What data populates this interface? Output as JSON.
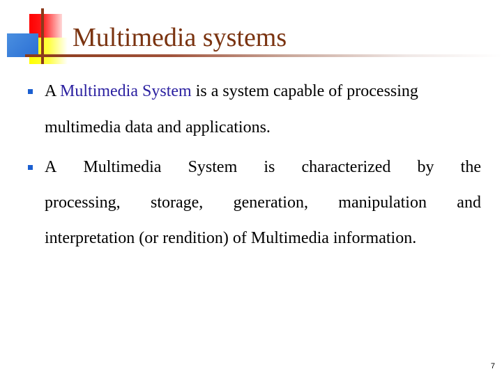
{
  "slide": {
    "title": "Multimedia systems",
    "bullets": [
      {
        "lines": [
          {
            "parts": [
              "A ",
              "Multimedia System",
              " is a system capable of processing"
            ]
          },
          {
            "text": "multimedia data and applications."
          }
        ]
      },
      {
        "lines": [
          {
            "words": [
              "A",
              "Multimedia",
              "System",
              "is",
              "characterized",
              "by",
              "the"
            ]
          },
          {
            "words": [
              "processing,",
              "storage,",
              "generation,",
              "manipulation",
              "and"
            ]
          },
          {
            "text": "interpretation (or rendition) of Multimedia information."
          }
        ]
      }
    ],
    "page_number": "7"
  },
  "colors": {
    "title": "#7a3310",
    "highlight": "#2a1fa0",
    "bullet": "#1b5fd0",
    "rule": "#8b3a1a"
  }
}
